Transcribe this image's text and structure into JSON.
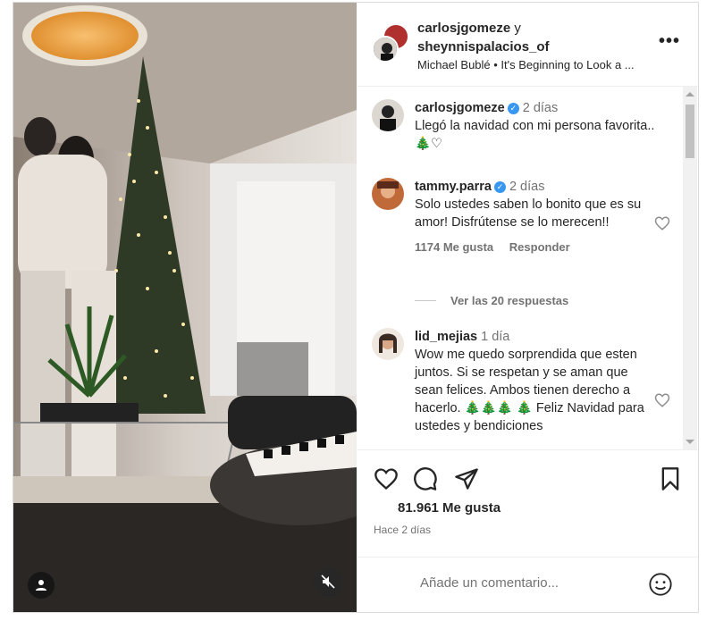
{
  "header": {
    "user1": "carlosjgomeze",
    "conjunction": "y",
    "user2": "sheynnispalacios_of",
    "song": "Michael Bublé • It's Beginning to Look a ...",
    "more_label": "•••"
  },
  "comments": [
    {
      "username": "carlosjgomeze",
      "verified": true,
      "time": "2 días",
      "text": "Llegó la navidad con mi persona favorita..🎄♡"
    },
    {
      "username": "tammy.parra",
      "verified": true,
      "time": "2 días",
      "text": "Solo ustedes saben lo bonito que es su amor! Disfrútense se lo merecen!!",
      "likes": "1174 Me gusta",
      "reply": "Responder",
      "view_replies": "Ver las 20 respuestas"
    },
    {
      "username": "lid_mejias",
      "verified": false,
      "time": "1 día",
      "text": "Wow me quedo sorprendida que esten juntos. Si se respetan y se aman que sean felices. Ambos tienen derecho a hacerlo. 🎄🎄🎄 🎄 Feliz Navidad para ustedes y bendiciones"
    }
  ],
  "post": {
    "likes": "81.961 Me gusta",
    "ago": "Hace 2 días",
    "comment_placeholder": "Añade un comentario..."
  },
  "icons": [
    "heart-icon",
    "comment-icon",
    "share-icon",
    "bookmark-icon",
    "emoji-icon",
    "mute-icon",
    "user-tag-icon",
    "more-icon"
  ],
  "colors": {
    "verified": "#3897f0",
    "muted_text": "#737373"
  }
}
